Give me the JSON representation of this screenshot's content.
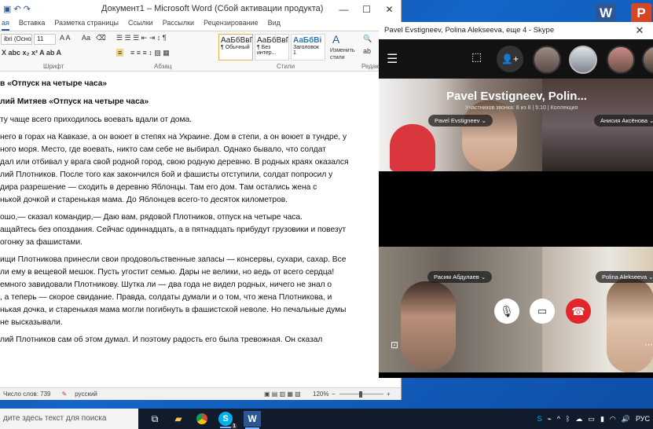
{
  "desktop": {
    "icons": [
      {
        "name": "word-icon",
        "glyph": "W",
        "color": "#2b5797"
      },
      {
        "name": "powerpoint-icon",
        "glyph": "P",
        "color": "#d24726"
      }
    ]
  },
  "word": {
    "title": "Документ1 – Microsoft Word (Сбой активации продукта)",
    "tabs": [
      "ая",
      "Вставка",
      "Разметка страницы",
      "Ссылки",
      "Рассылки",
      "Рецензирование",
      "Вид"
    ],
    "active_tab": "ая",
    "ribbon": {
      "font_name": "ibri (Основ",
      "font_size": "11",
      "styles": [
        {
          "sample": "АаБбВвГг,",
          "label": "¶ Обычный"
        },
        {
          "sample": "АаБбВвГг,",
          "label": "¶ Без интер..."
        },
        {
          "sample": "АаБбВі",
          "label": "Заголовок 1"
        }
      ],
      "change_styles": "Изменить стили",
      "edit_label": "Редакти",
      "group_font": "Шрифт",
      "group_para": "Абзац",
      "group_styles": "Стили"
    },
    "doc_lines": [
      {
        "text": "в «Отпуск на четыре часа»",
        "bold": true
      },
      {
        "text": "лий Митяев «Отпуск на четыре часа»",
        "bold": true
      },
      {
        "text": "ту чаще всего приходилось воевать вдали от дома.",
        "bold": false,
        "gap": true
      },
      {
        "text": "него в горах на Кавказе, а он воюет в степях на Украине. Дом в степи, а он воюет в тундре, у",
        "bold": false,
        "gap": true
      },
      {
        "text": "ного моря. Место, где воевать, никто сам себе не выбирал. Однако бывало, что солдат",
        "bold": false
      },
      {
        "text": "дал или отбивал у врага свой родной город, свою родную деревню. В родных краях оказался",
        "bold": false
      },
      {
        "text": "лий Плотников. После того как закончился бой и фашисты отступили, солдат попросил у",
        "bold": false
      },
      {
        "text": "дира разрешение — сходить в деревню Яблонцы. Там его дом. Там остались жена с",
        "bold": false
      },
      {
        "text": "нькой дочкой и старенькая мама. До Яблонцев всего-то десяток километров.",
        "bold": false
      },
      {
        "text": "ошо,— сказал командир,— Даю вам, рядовой Плотников, отпуск на четыре часа.",
        "bold": false,
        "gap": true
      },
      {
        "text": "ащайтесь без опоздания. Сейчас одиннадцать, а в пятнадцать прибудут грузовики и повезут",
        "bold": false
      },
      {
        "text": "огонку за фашистами.",
        "bold": false
      },
      {
        "text": "ищи Плотникова принесли свои продовольственные запасы — консервы, сухари, сахар. Все",
        "bold": false,
        "gap": true
      },
      {
        "text": "ли ему в вещевой мешок. Пусть угостит семью. Дары не велики, но ведь от всего сердца!",
        "bold": false
      },
      {
        "text": "емного завидовали Плотникову. Шутка ли — два года не видел родных, ничего не знал о",
        "bold": false
      },
      {
        "text": ", а теперь — скорое свидание. Правда, солдаты думали и о том, что жена Плотникова, и",
        "bold": false
      },
      {
        "text": "нькая дочка, и старенькая мама могли погибнуть в фашистской неволе. Но печальные думы",
        "bold": false
      },
      {
        "text": "не высказывали.",
        "bold": false
      },
      {
        "text": "лий Плотников сам об этом думал. И поэтому радость его была тревожная. Он сказал",
        "bold": false,
        "gap": true
      }
    ],
    "status": {
      "words": "Число слов: 739",
      "language": "русский",
      "zoom": "120%"
    }
  },
  "skype": {
    "title": "Pavel  Evstigneev, Polina Alekseeva, еще 4 - Skype",
    "call_title": "Pavel  Evstigneev, Polin...",
    "call_sub": "Участников звонка: 8 из 8 | 5:10 | Коллекция",
    "participants": [
      {
        "name": "Pavel  Evstigneev"
      },
      {
        "name": "Анисия Аксёнова"
      },
      {
        "name": "Расим Абдулаев"
      },
      {
        "name": "Polina Alekseeva"
      }
    ]
  },
  "taskbar": {
    "search_placeholder": "дите здесь текст для поиска",
    "badge": "1",
    "language": "РУС"
  }
}
